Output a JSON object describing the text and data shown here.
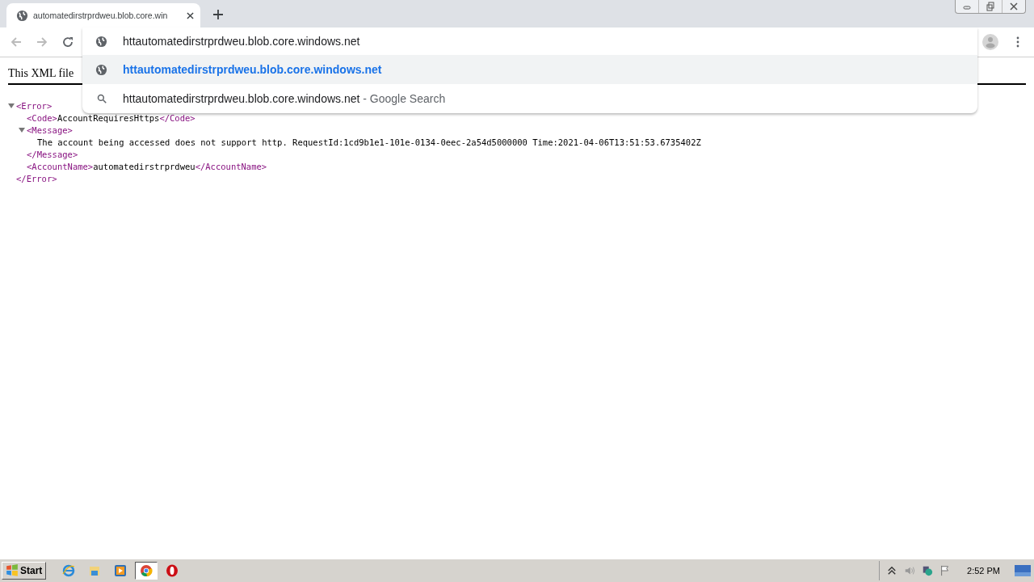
{
  "tab": {
    "title": "automatedirstrprdweu.blob.core.win"
  },
  "omnibox": {
    "value": "httautomatedirstrprdweu.blob.core.windows.net"
  },
  "suggestions": [
    {
      "kind": "url",
      "text": "httautomatedirstrprdweu.blob.core.windows.net",
      "selected": true
    },
    {
      "kind": "search",
      "text": "httautomatedirstrprdweu.blob.core.windows.net",
      "suffix": " - Google Search",
      "selected": false
    }
  ],
  "xml_banner": "This XML file",
  "xml": {
    "open": "<Error>",
    "close": "</Error>",
    "expanded": true,
    "children": [
      {
        "open": "<Code>",
        "text": "AccountRequiresHttps",
        "close": "</Code>"
      },
      {
        "open": "<Message>",
        "close": "</Message>",
        "expanded": true,
        "children": [
          {
            "text": "The account being accessed does not support http. RequestId:1cd9b1e1-101e-0134-0eec-2a54d5000000 Time:2021-04-06T13:51:53.6735402Z"
          }
        ]
      },
      {
        "open": "<AccountName>",
        "text": "automatedirstrprdweu",
        "close": "</AccountName>"
      }
    ]
  },
  "taskbar": {
    "start": "Start",
    "apps": [
      {
        "kind": "ie",
        "selected": false
      },
      {
        "kind": "explorer",
        "selected": false
      },
      {
        "kind": "media",
        "selected": false
      },
      {
        "kind": "chrome",
        "selected": true
      },
      {
        "kind": "opera",
        "selected": false
      }
    ],
    "clock": "2:52 PM"
  }
}
